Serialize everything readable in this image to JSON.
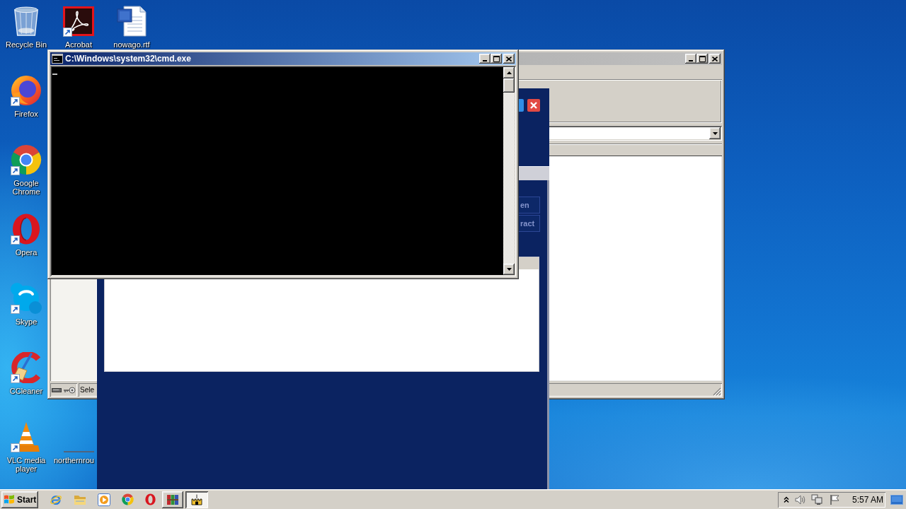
{
  "desktop": {
    "icons": [
      {
        "label": "Recycle Bin",
        "kind": "recycle-bin",
        "shortcut": false
      },
      {
        "label": "Acrobat",
        "kind": "pdf-app",
        "shortcut": true
      },
      {
        "label": "nowago.rtf",
        "kind": "document",
        "shortcut": false
      },
      {
        "label": "Firefox",
        "kind": "firefox",
        "shortcut": true
      },
      {
        "label": "Google Chrome",
        "kind": "chrome",
        "shortcut": true
      },
      {
        "label": "Opera",
        "kind": "opera",
        "shortcut": true
      },
      {
        "label": "Skype",
        "kind": "skype",
        "shortcut": true
      },
      {
        "label": "CCleaner",
        "kind": "ccleaner",
        "shortcut": true
      },
      {
        "label": "VLC media player",
        "kind": "vlc",
        "shortcut": true
      },
      {
        "label": "northernrou",
        "kind": "picture",
        "shortcut": false
      }
    ]
  },
  "windows": [
    {
      "kind": "explorer",
      "active": false,
      "status_bar": {
        "text": "Sele"
      }
    },
    {
      "kind": "installer",
      "buttons": [
        "en",
        "ract"
      ]
    },
    {
      "kind": "console",
      "active": true,
      "title": "C:\\Windows\\system32\\cmd.exe"
    }
  ],
  "taskbar": {
    "start": "Start",
    "tasks": [
      {
        "kind": "archive",
        "selected": false
      },
      {
        "kind": "app",
        "selected": true
      }
    ],
    "tray": {
      "clock": "5:57 AM"
    }
  }
}
